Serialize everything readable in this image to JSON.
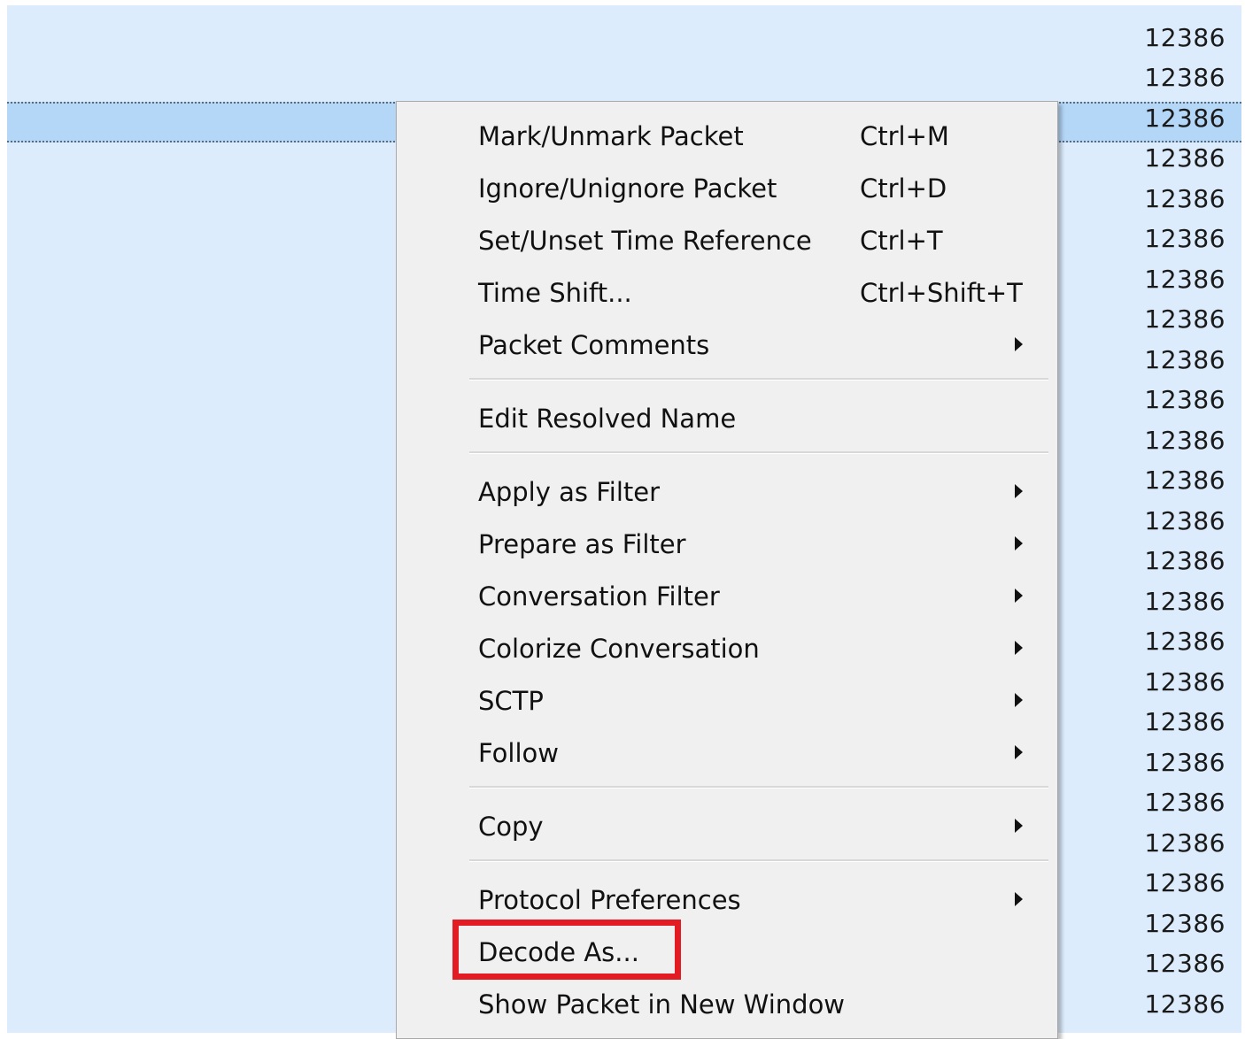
{
  "packet_list": {
    "port_column": [
      "12386",
      "12386",
      "12386",
      "12386",
      "12386",
      "12386",
      "12386",
      "12386",
      "12386",
      "12386",
      "12386",
      "12386",
      "12386",
      "12386",
      "12386",
      "12386",
      "12386",
      "12386",
      "12386",
      "12386",
      "12386",
      "12386",
      "12386",
      "12386",
      "12386"
    ]
  },
  "context_menu": {
    "items": [
      {
        "label": "Mark/Unmark Packet",
        "shortcut": "Ctrl+M"
      },
      {
        "label": "Ignore/Unignore Packet",
        "shortcut": "Ctrl+D"
      },
      {
        "label": "Set/Unset Time Reference",
        "shortcut": "Ctrl+T"
      },
      {
        "label": "Time Shift...",
        "shortcut": "Ctrl+Shift+T"
      },
      {
        "label": "Packet Comments",
        "shortcut": ""
      },
      {
        "label": "Edit Resolved Name",
        "shortcut": ""
      },
      {
        "label": "Apply as Filter",
        "shortcut": ""
      },
      {
        "label": "Prepare as Filter",
        "shortcut": ""
      },
      {
        "label": "Conversation Filter",
        "shortcut": ""
      },
      {
        "label": "Colorize Conversation",
        "shortcut": ""
      },
      {
        "label": "SCTP",
        "shortcut": ""
      },
      {
        "label": "Follow",
        "shortcut": ""
      },
      {
        "label": "Copy",
        "shortcut": ""
      },
      {
        "label": "Protocol Preferences",
        "shortcut": ""
      },
      {
        "label": "Decode As...",
        "shortcut": ""
      },
      {
        "label": "Show Packet in New Window",
        "shortcut": ""
      }
    ]
  },
  "colors": {
    "list_background": "#dcecfc",
    "selected_row": "#b5d7f7",
    "menu_background": "#f0f0f0",
    "highlight": "#e31b23"
  }
}
